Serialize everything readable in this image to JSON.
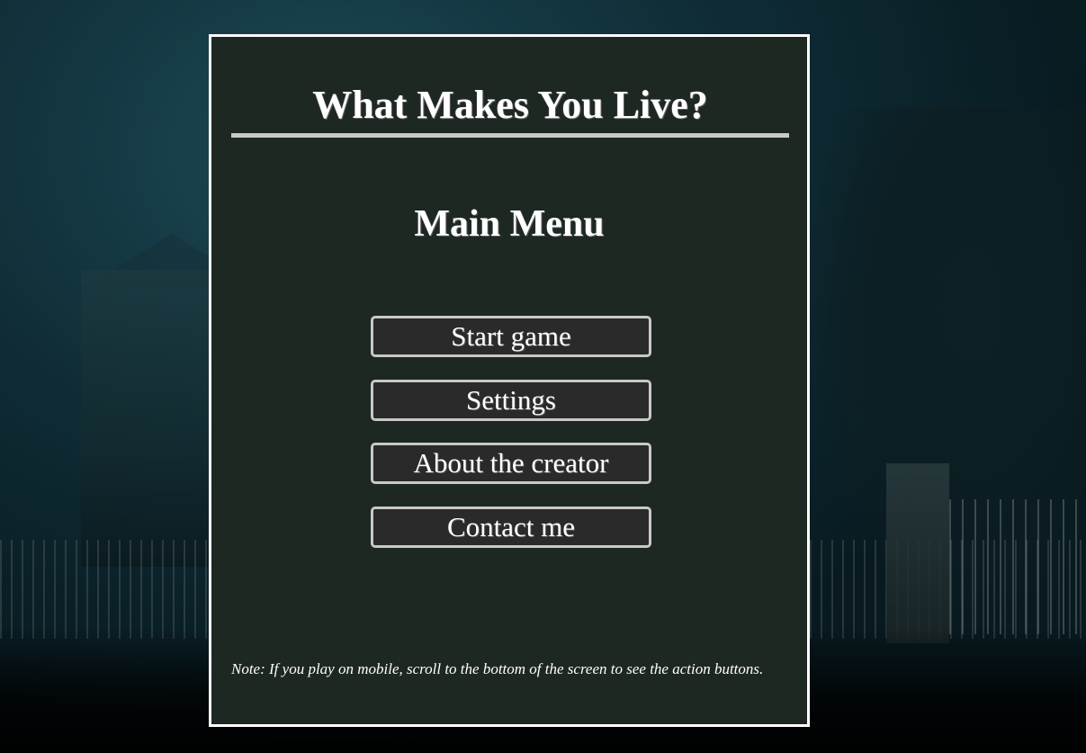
{
  "game": {
    "title": "What Makes You Live?"
  },
  "menu": {
    "heading": "Main Menu",
    "buttons": [
      {
        "label": "Start game"
      },
      {
        "label": "Settings"
      },
      {
        "label": "About the creator"
      },
      {
        "label": "Contact me"
      }
    ]
  },
  "footer": {
    "note": "Note: If you play on mobile, scroll to the bottom of the screen to see the action buttons."
  },
  "colors": {
    "panel_background": "#1e2822",
    "panel_border": "#ffffff",
    "button_background": "#2a2a2a",
    "button_border": "#c8c8c8",
    "text": "#ffffff"
  }
}
